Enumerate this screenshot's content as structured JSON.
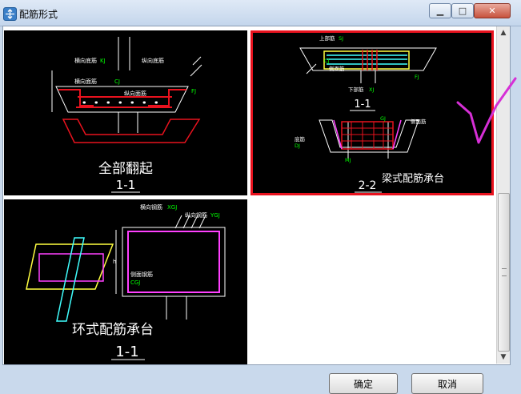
{
  "window": {
    "title": "配筋形式"
  },
  "controls": {
    "minimize": "▁",
    "maximize": "□",
    "close": "✕"
  },
  "options": [
    {
      "caption": "全部翻起",
      "section": "1-1",
      "labels": {
        "long_bar": "横向底筋",
        "trans_bar": "纵向底筋",
        "top_long": "横向面筋",
        "top_trans": "纵向面筋",
        "tag_top": "KJ",
        "tag_trans": "CJ",
        "tag_fj": "FJ"
      }
    },
    {
      "caption": "梁式配筋承台",
      "section_a": "1-1",
      "section_b": "2-2",
      "labels": {
        "top_bar": "上部筋",
        "sj": "SJ",
        "cj": "CJ",
        "side_bar": "侧面筋",
        "bottom_bar": "下部筋",
        "xj": "XJ",
        "fj": "FJ",
        "gj": "GJ",
        "mj": "MJ",
        "bottom_b": "底筋",
        "dj": "DJ",
        "cjs": "侧面筋"
      }
    },
    {
      "caption": "环式配筋承台",
      "section": "1-1",
      "labels": {
        "h_bar": "横向钢筋",
        "xgj": "XGJ",
        "v_bar": "纵向钢筋",
        "ygj": "YGJ",
        "side": "侧面钢筋",
        "cgj": "CGJ",
        "h": "h"
      }
    }
  ],
  "buttons": {
    "ok": "确定",
    "cancel": "取消"
  },
  "colors": {
    "accent_red": "#e8121e",
    "magenta": "#ff40ff",
    "annotation": "#d62fd6"
  }
}
